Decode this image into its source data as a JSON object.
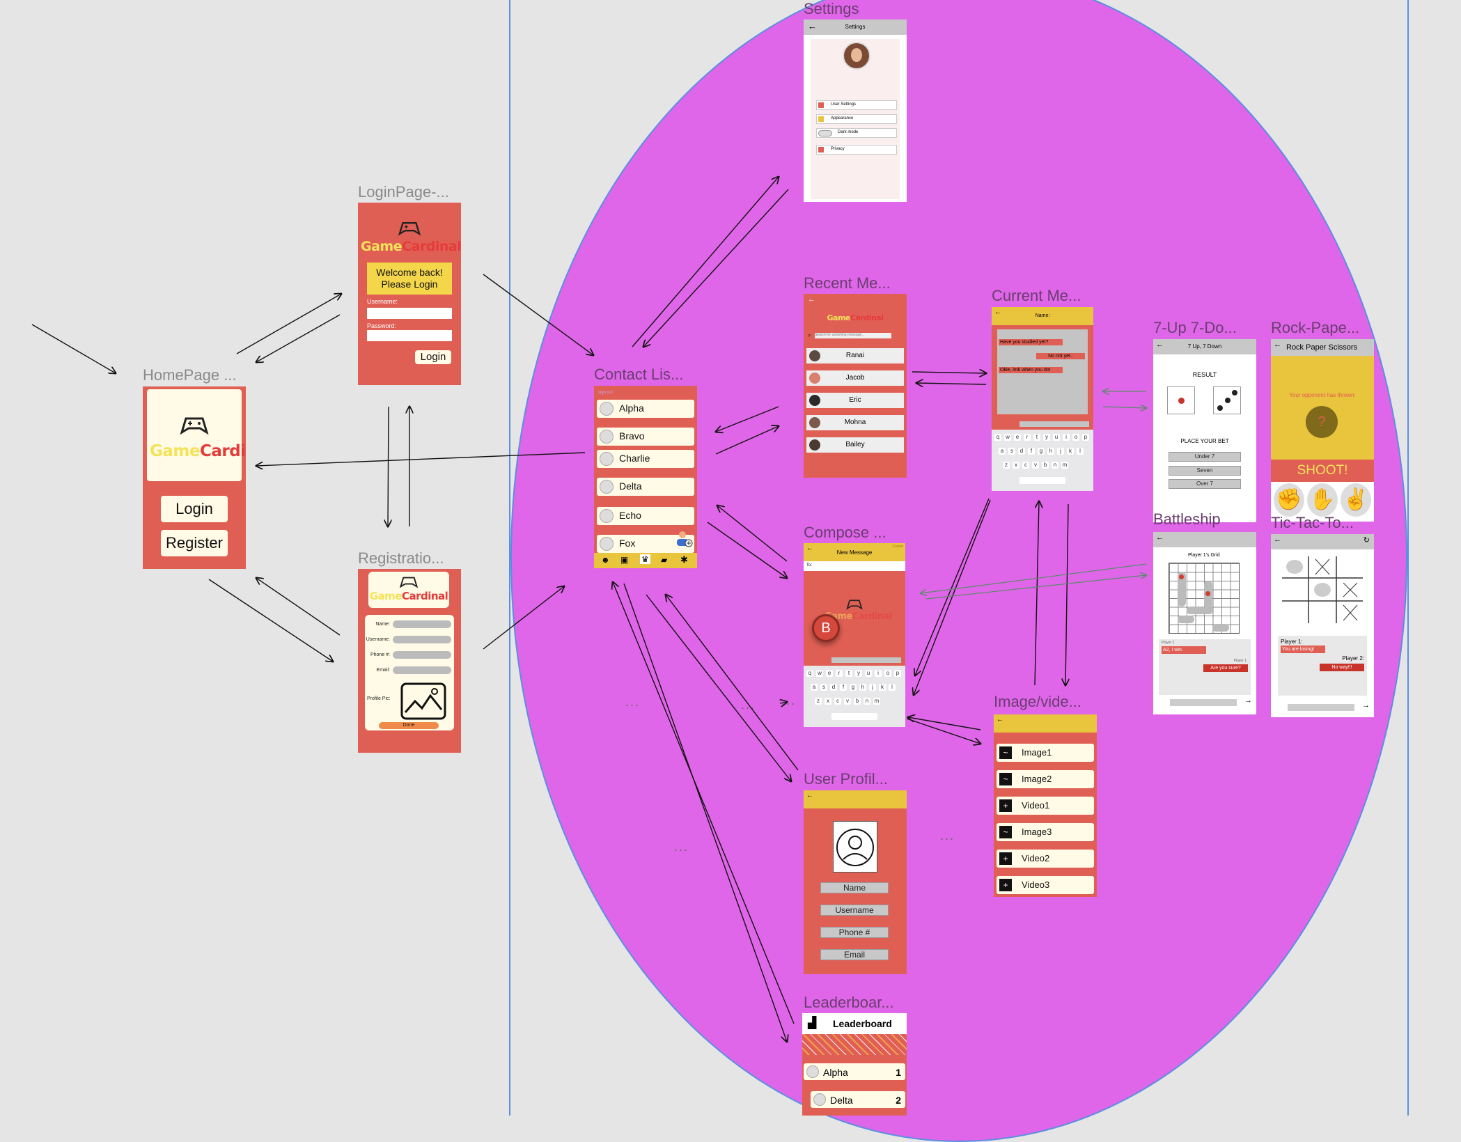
{
  "frames": {
    "homepage": {
      "label": "HomePage ...",
      "logo": {
        "part1": "Game",
        "part2": "Cardinal"
      },
      "login_label": "Login",
      "register_label": "Register"
    },
    "loginpage": {
      "label": "LoginPage-...",
      "logo": {
        "part1": "Game",
        "part2": "Cardinal"
      },
      "welcome_line1": "Welcome back!",
      "welcome_line2": "Please Login",
      "username_label": "Username:",
      "password_label": "Password:",
      "login_button": "Login"
    },
    "registration": {
      "label": "Registratio...",
      "logo": {
        "part1": "Game",
        "part2": "Cardinal"
      },
      "fields": [
        "Name:",
        "Username:",
        "Phone #:",
        "Email:"
      ],
      "profile_pic_label": "Profile Pic:",
      "done_label": "Done"
    },
    "contacts": {
      "label": "Contact Lis...",
      "header_hint": "sign out",
      "contacts": [
        "Alpha",
        "Bravo",
        "Charlie",
        "Delta",
        "Echo",
        "Fox"
      ]
    },
    "settings": {
      "label": "Settings",
      "title": "Settings",
      "items": [
        "User Settings",
        "Appearance",
        "Dark mode",
        "Privacy"
      ]
    },
    "recent": {
      "label": "Recent Me...",
      "logo": {
        "part1": "Game",
        "part2": "Cardinal"
      },
      "search_placeholder": "Search for vanishing message...",
      "people": [
        "Ranai",
        "Jacob",
        "Eric",
        "Mohna",
        "Bailey"
      ]
    },
    "current": {
      "label": "Current Me...",
      "name_label": "Name:",
      "messages": [
        "Have you studied yet?",
        "No not yet..",
        "Okie, lmk when you do!"
      ]
    },
    "compose": {
      "label": "Compose ...",
      "title": "New Message",
      "cancel": "Cancel",
      "to_label": "To:",
      "logo": {
        "part1": "Game",
        "part2": "Cardinal"
      },
      "badge": "B"
    },
    "profile": {
      "label": "User Profil...",
      "fields": [
        "Name",
        "Username",
        "Phone #",
        "Email"
      ]
    },
    "leaderboard": {
      "label": "Leaderboar...",
      "title": "Leaderboard",
      "rows": [
        {
          "name": "Alpha",
          "rank": "1"
        },
        {
          "name": "Delta",
          "rank": "2"
        }
      ]
    },
    "media": {
      "label": "Image/vide...",
      "items": [
        "Image1",
        "Image2",
        "Video1",
        "Image3",
        "Video2",
        "Video3"
      ]
    },
    "sevenup": {
      "label": "7-Up 7-Do...",
      "title": "7 Up, 7 Down",
      "result": "RESULT",
      "place_bet": "PLACE YOUR BET",
      "bets": [
        "Under 7",
        "Seven",
        "Over 7"
      ]
    },
    "rps": {
      "label": "Rock-Pape...",
      "title": "Rock Paper Scissors",
      "opponent": "Your opponent has thrown:",
      "question": "?",
      "shoot": "SHOOT!"
    },
    "battleship": {
      "label": "Battleship",
      "grid_title": "Player 1's Grid",
      "p2": "Player 2",
      "msg1": "A2, I win.",
      "p1": "Player 1",
      "msg2": "Are you sure?"
    },
    "tictactoe": {
      "label": "Tic-Tac-To...",
      "p1": "Player 1:",
      "msg1": "You are losing!",
      "p2": "Player 2:",
      "msg2": "No way!!!"
    }
  },
  "ellipsis": "...",
  "colors": {
    "canvas": "#e5e5e5",
    "region": "#df66e8",
    "coral": "#e05f54",
    "yellow": "#e9c43d",
    "cream": "#fffbe6"
  }
}
